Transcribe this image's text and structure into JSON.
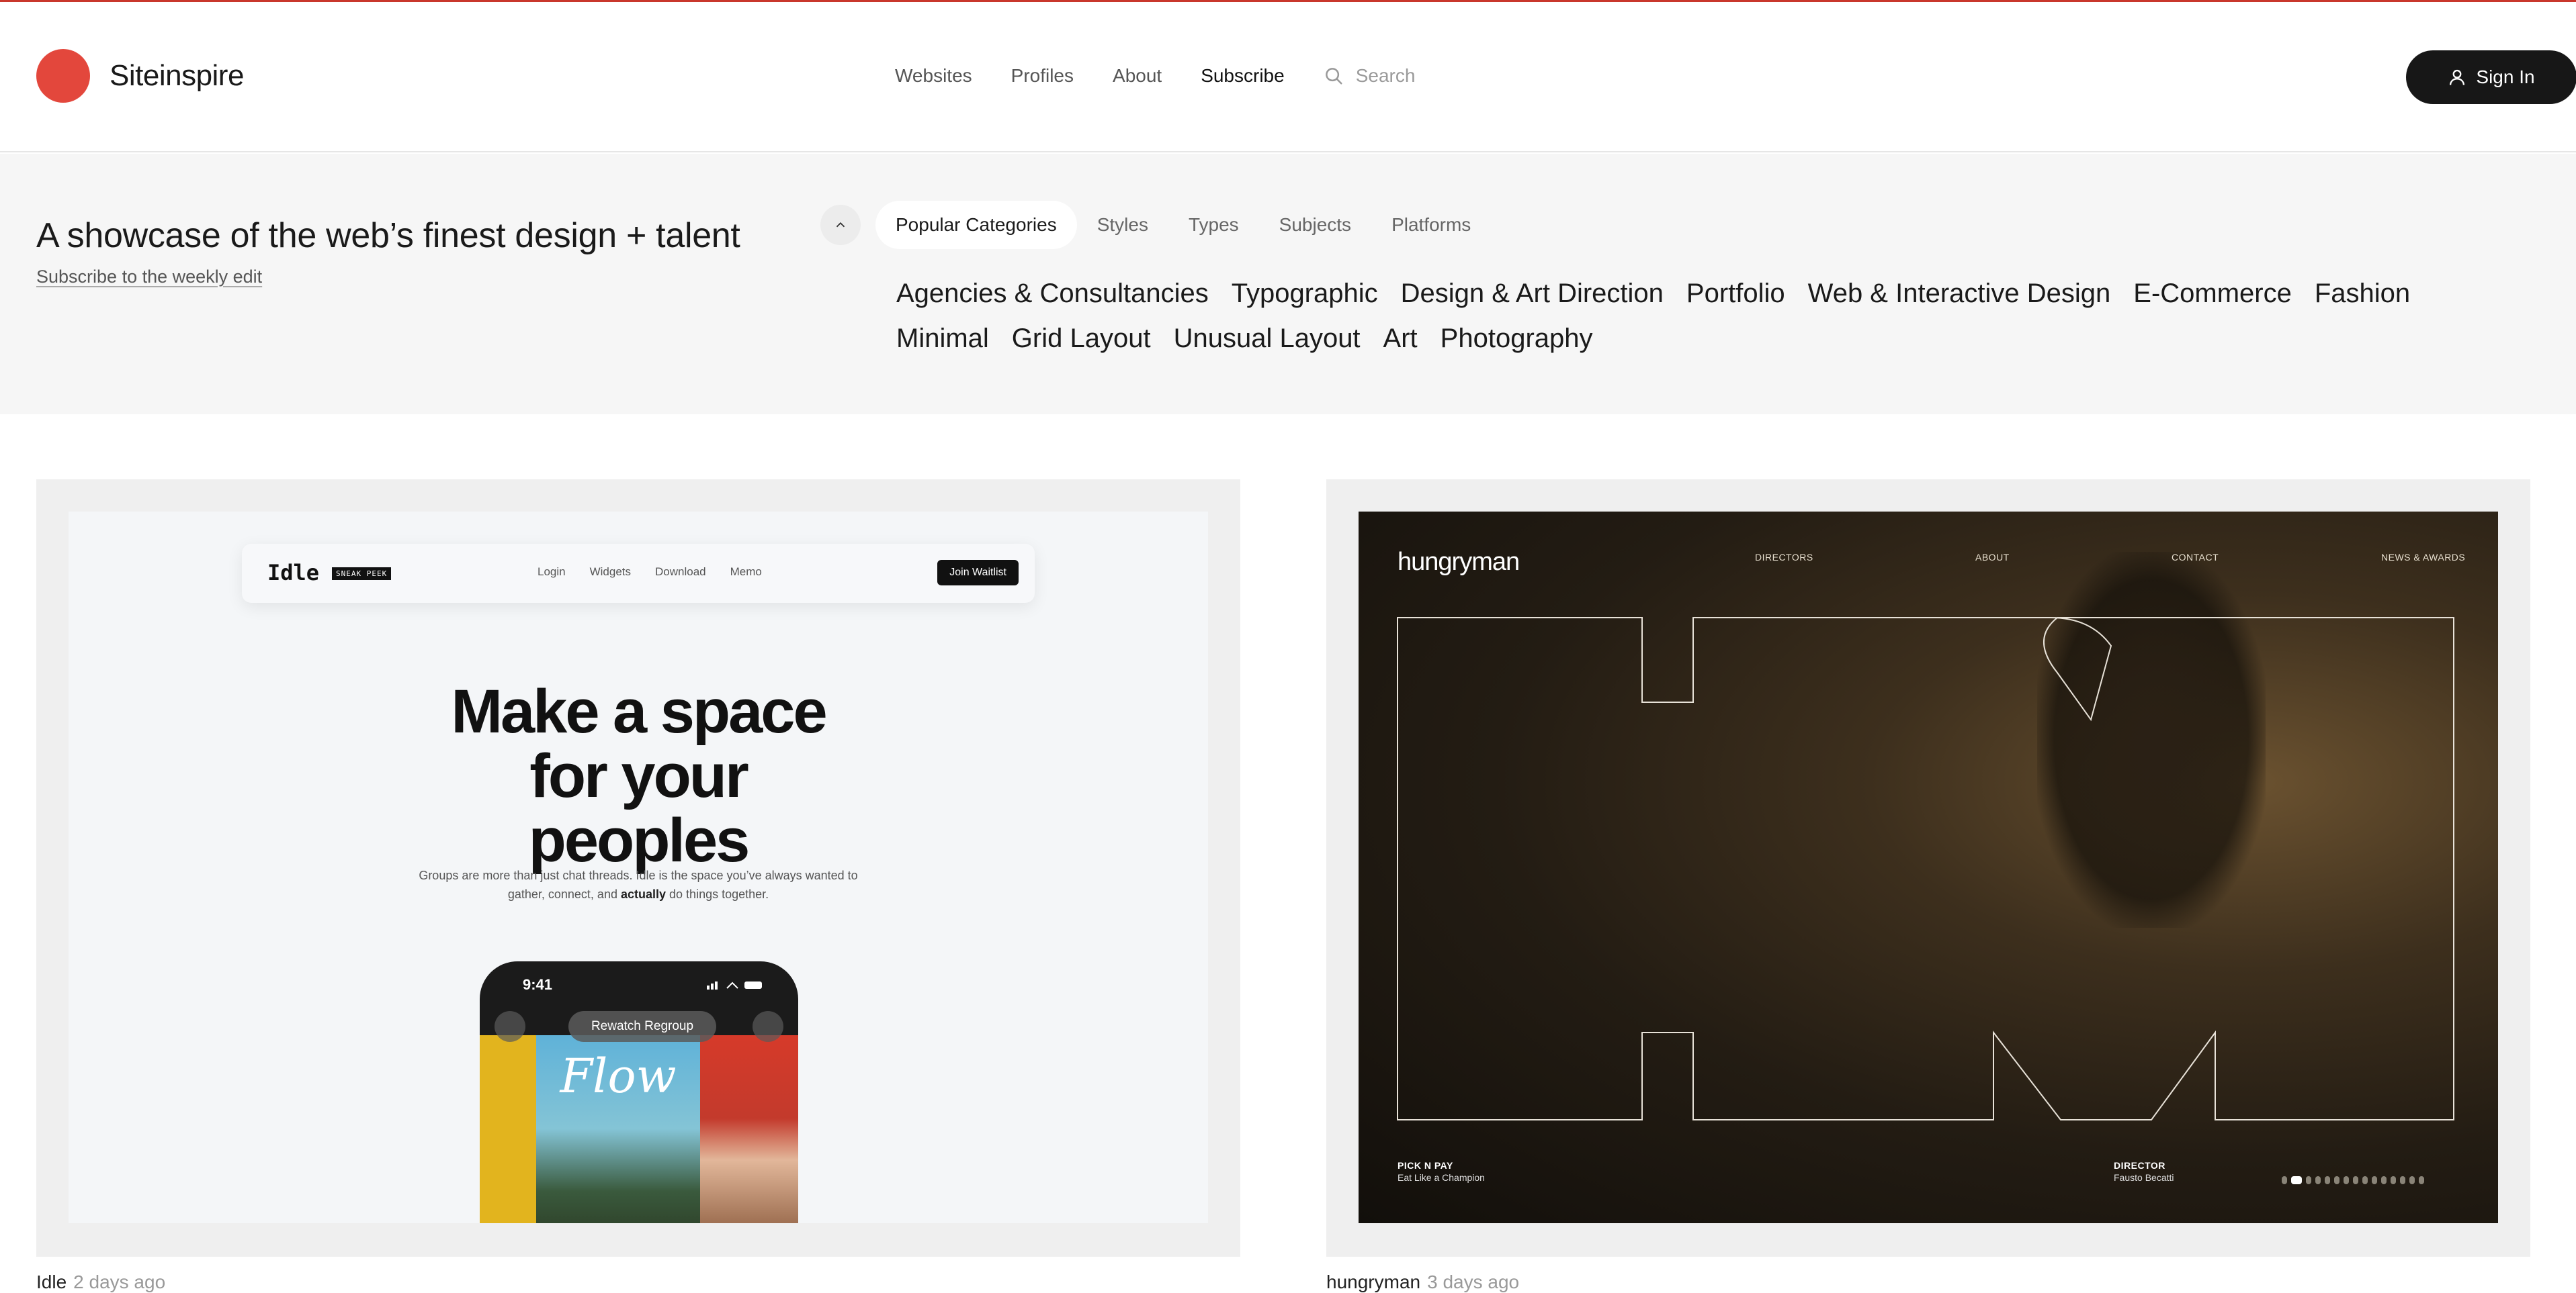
{
  "header": {
    "brand": "Siteinspire",
    "nav": [
      "Websites",
      "Profiles",
      "About",
      "Subscribe"
    ],
    "search_placeholder": "Search",
    "sign_in": "Sign In"
  },
  "hero": {
    "tagline": "A showcase of the web’s finest design + talent",
    "subscribe_link": "Subscribe to the weekly edit",
    "tabs": [
      "Popular Categories",
      "Styles",
      "Types",
      "Subjects",
      "Platforms"
    ],
    "categories_row1": [
      "Agencies & Consultancies",
      "Typographic",
      "Design & Art Direction",
      "Portfolio",
      "Web & Interactive Design",
      "E-Commerce",
      "Fashion"
    ],
    "categories_row2": [
      "Minimal",
      "Grid Layout",
      "Unusual Layout",
      "Art",
      "Photography"
    ]
  },
  "cards": [
    {
      "title": "Idle",
      "ago": "2 days ago",
      "shot": {
        "logo": "Idle",
        "badge": "SNEAK PEEK",
        "links": [
          "Login",
          "Widgets",
          "Download",
          "Memo"
        ],
        "cta": "Join Waitlist",
        "headline": "Make a space for your peoples",
        "sub_1": "Groups are more than just chat threads. Idle is the space you’ve always wanted to",
        "sub_2_pre": "gather, connect, and ",
        "sub_2_bold": "actually",
        "sub_2_post": " do things together.",
        "phone_time": "9:41",
        "phone_pill": "Rewatch Regroup",
        "poster_title": "Flow"
      }
    },
    {
      "title": "hungryman",
      "ago": "3 days ago",
      "shot": {
        "logo": "hungryman",
        "nav": [
          "DIRECTORS",
          "ABOUT",
          "CONTACT",
          "NEWS & AWARDS"
        ],
        "client_label": "PICK N PAY",
        "client_value": "Eat Like a Champion",
        "director_label": "DIRECTOR",
        "director_value": "Fausto Becatti",
        "slides_total": 15,
        "slide_active": 2
      }
    }
  ],
  "colors": {
    "accent": "#e3473c",
    "top_border": "#c9372c",
    "button": "#171717",
    "band": "#f6f6f6"
  }
}
